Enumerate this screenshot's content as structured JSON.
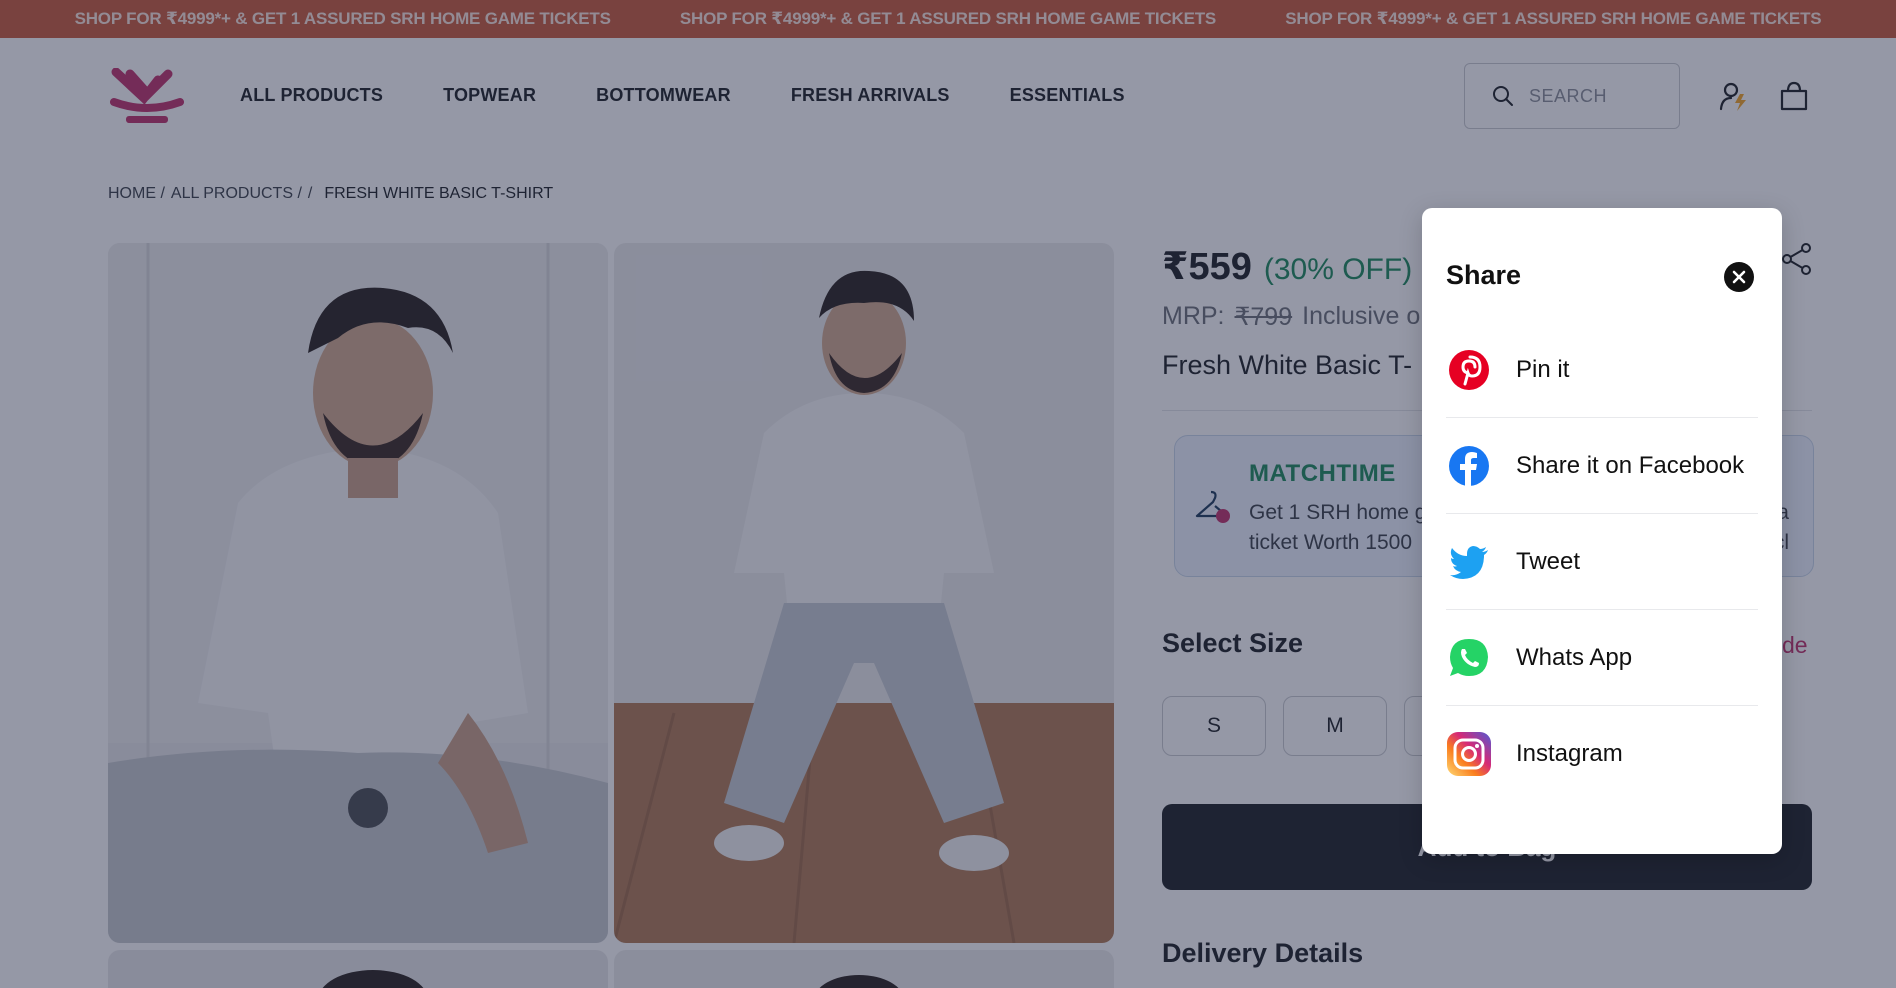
{
  "announcement": {
    "items": [
      "SHOP FOR ₹4999*+ & GET 1 ASSURED SRH HOME GAME TICKETS",
      "SHOP FOR ₹4999*+ & GET 1 ASSURED SRH HOME GAME TICKETS",
      "SHOP FOR ₹4999*+ & GET 1 ASSURED SRH HOME GAME TICKETS"
    ]
  },
  "nav": {
    "links": [
      "ALL PRODUCTS",
      "TOPWEAR",
      "BOTTOMWEAR",
      "FRESH ARRIVALS",
      "ESSENTIALS"
    ]
  },
  "search": {
    "placeholder": "SEARCH"
  },
  "breadcrumb": {
    "home": "HOME /",
    "all_products": "ALL PRODUCTS /",
    "sep": "/",
    "current": "FRESH WHITE BASIC T-SHIRT"
  },
  "product": {
    "price": "₹559",
    "discount": "(30% OFF)",
    "mrp_label": "MRP:",
    "mrp_value": "₹799",
    "tax_note": "Inclusive o",
    "name": "Fresh White Basic T-"
  },
  "offer": {
    "title": "MATCHTIME",
    "line1": "Get 1 SRH home g",
    "line1_tail": "tra",
    "line2": "ticket Worth 1500",
    "line2_tail": "urcl"
  },
  "sizes": {
    "heading": "Select Size",
    "guide_label": "de",
    "options": [
      "S",
      "M"
    ]
  },
  "cta": {
    "add_to_bag": "Add to Bag"
  },
  "delivery": {
    "heading": "Delivery Details"
  },
  "share_modal": {
    "title": "Share",
    "items": [
      {
        "label": "Pin it",
        "icon": "pinterest-icon",
        "color": "#e60023"
      },
      {
        "label": "Share it on Facebook",
        "icon": "facebook-icon",
        "color": "#1877f2"
      },
      {
        "label": "Tweet",
        "icon": "twitter-icon",
        "color": "#1da1f2"
      },
      {
        "label": "Whats App",
        "icon": "whatsapp-icon",
        "color": "#25d366"
      },
      {
        "label": "Instagram",
        "icon": "instagram-icon",
        "color": "#dd2a7b"
      }
    ]
  },
  "colors": {
    "announcement_bg": "#c95a3a",
    "brand": "#c0306a",
    "discount": "#1b8a5a",
    "overlay": "rgba(34, 40, 70, 0.48)"
  }
}
